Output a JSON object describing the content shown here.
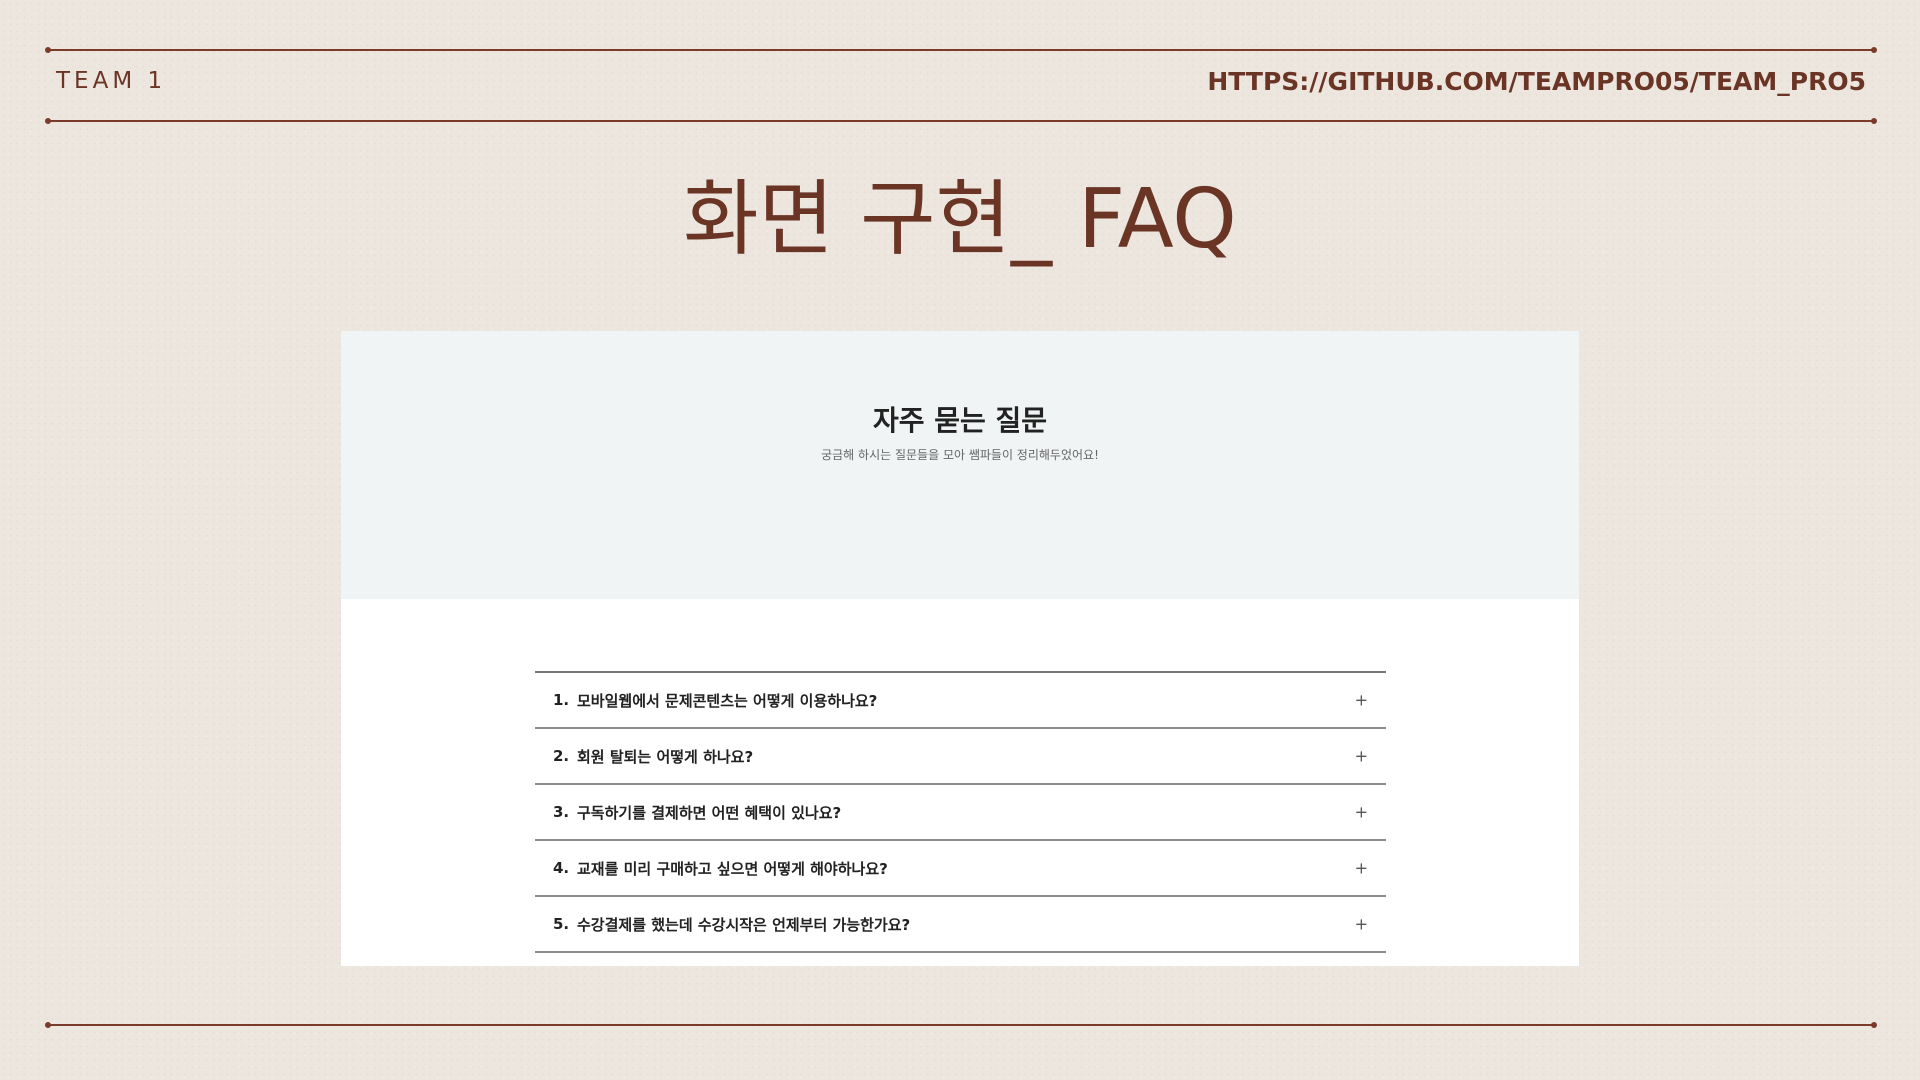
{
  "header": {
    "team": "TEAM 1",
    "url": "HTTPS://GITHUB.COM/TEAMPRO05/TEAM_PRO5"
  },
  "slide": {
    "title": "화면 구현_ FAQ"
  },
  "faq_page": {
    "title": "자주 묻는 질문",
    "subtitle": "궁금해 하시는 질문들을 모아 쌤파들이 정리해두었어요!",
    "expand_icon": "+",
    "items": [
      {
        "num": "1.",
        "question": "모바일웹에서 문제콘텐츠는 어떻게 이용하나요?"
      },
      {
        "num": "2.",
        "question": "회원 탈퇴는 어떻게 하나요?"
      },
      {
        "num": "3.",
        "question": "구독하기를 결제하면 어떤 혜택이 있나요?"
      },
      {
        "num": "4.",
        "question": "교재를 미리 구매하고 싶으면 어떻게 해야하나요?"
      },
      {
        "num": "5.",
        "question": "수강결제를 했는데 수강시작은 언제부터 가능한가요?"
      }
    ]
  },
  "colors": {
    "accent": "#7a3b2a",
    "background": "#ece6de",
    "hero_bg": "#f0f4f4"
  }
}
